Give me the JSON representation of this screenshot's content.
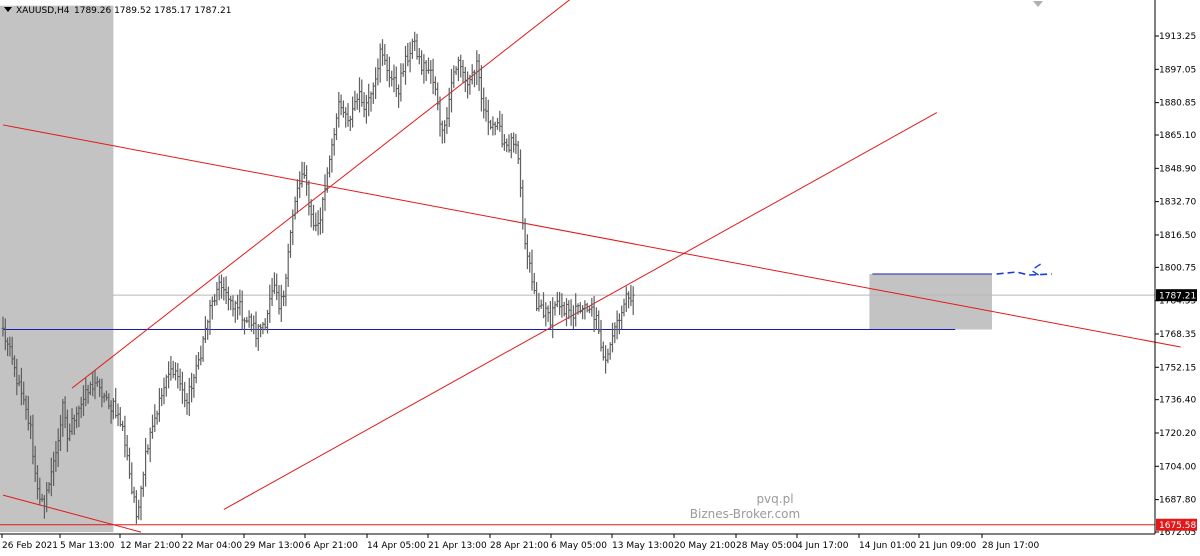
{
  "header": {
    "symbol": "XAUUSD,H4",
    "ohlc": "1789.26 1789.52 1785.17 1787.21"
  },
  "watermark": {
    "line1": "pvq.pl",
    "line2": "Biznes-Broker.com"
  },
  "price_badges": {
    "current": {
      "value": 1787.21,
      "label": "1787.21",
      "bg": "#000000",
      "fg": "#ffffff"
    },
    "low": {
      "value": 1675.58,
      "label": "1675.58",
      "bg": "#e31818",
      "fg": "#ffffff"
    }
  },
  "colors": {
    "candle": "#5f5f5f",
    "trendline": "#e31818",
    "level": "#1c1cb5",
    "forecast": "#1a3fd6",
    "shade": "#c3c3c3",
    "grid_current": "#b8b8b8"
  },
  "chart_data": {
    "type": "bar",
    "subtype": "ohlc",
    "symbol": "XAUUSD",
    "timeframe": "H4",
    "ylim": [
      1670.0,
      1930.0
    ],
    "y_ticks": [
      1913.25,
      1897.05,
      1880.85,
      1865.1,
      1848.9,
      1832.7,
      1816.5,
      1800.75,
      1784.55,
      1768.35,
      1752.15,
      1736.4,
      1720.2,
      1704.0,
      1687.8,
      1672.05
    ],
    "y_tick_labels": [
      "1913.25",
      "1897.05",
      "1880.85",
      "1865.10",
      "1848.90",
      "1832.70",
      "1816.50",
      "1800.75",
      "1784.55",
      "1768.35",
      "1752.15",
      "1736.40",
      "1720.20",
      "1704.00",
      "1687.80",
      "1672.05"
    ],
    "x_tick_labels": [
      "26 Feb 2021",
      "5 Mar 13:00",
      "12 Mar 21:00",
      "22 Mar 04:00",
      "29 Mar 13:00",
      "6 Apr 21:00",
      "14 Apr 05:00",
      "21 Apr 13:00",
      "28 Apr 21:00",
      "6 May 05:00",
      "13 May 13:00",
      "20 May 21:00",
      "28 May 05:00",
      "4 Jun 17:00",
      "14 Jun 01:00",
      "21 Jun 09:00",
      "28 Jun 17:00"
    ],
    "close_path": [
      [
        0,
        1770
      ],
      [
        2,
        1755
      ],
      [
        4,
        1738
      ],
      [
        6,
        1722
      ],
      [
        7,
        1700
      ],
      [
        8,
        1690
      ],
      [
        9,
        1682
      ],
      [
        10,
        1698
      ],
      [
        11,
        1705
      ],
      [
        12,
        1718
      ],
      [
        13,
        1732
      ],
      [
        14,
        1718
      ],
      [
        15,
        1725
      ],
      [
        16,
        1732
      ],
      [
        17,
        1735
      ],
      [
        18,
        1738
      ],
      [
        19,
        1742
      ],
      [
        20,
        1745
      ],
      [
        21,
        1740
      ],
      [
        22,
        1738
      ],
      [
        23,
        1732
      ],
      [
        24,
        1735
      ],
      [
        25,
        1728
      ],
      [
        26,
        1722
      ],
      [
        27,
        1710
      ],
      [
        28,
        1692
      ],
      [
        29,
        1680
      ],
      [
        30,
        1695
      ],
      [
        31,
        1710
      ],
      [
        32,
        1722
      ],
      [
        33,
        1728
      ],
      [
        34,
        1735
      ],
      [
        35,
        1742
      ],
      [
        36,
        1748
      ],
      [
        37,
        1752
      ],
      [
        38,
        1748
      ],
      [
        39,
        1740
      ],
      [
        40,
        1735
      ],
      [
        41,
        1744
      ],
      [
        42,
        1750
      ],
      [
        43,
        1760
      ],
      [
        44,
        1770
      ],
      [
        45,
        1780
      ],
      [
        46,
        1786
      ],
      [
        47,
        1790
      ],
      [
        48,
        1792
      ],
      [
        49,
        1784
      ],
      [
        50,
        1780
      ],
      [
        51,
        1784
      ],
      [
        52,
        1778
      ],
      [
        53,
        1775
      ],
      [
        54,
        1774
      ],
      [
        55,
        1768
      ],
      [
        56,
        1772
      ],
      [
        57,
        1775
      ],
      [
        58,
        1784
      ],
      [
        59,
        1790
      ],
      [
        60,
        1780
      ],
      [
        61,
        1788
      ],
      [
        62,
        1810
      ],
      [
        63,
        1825
      ],
      [
        64,
        1838
      ],
      [
        65,
        1845
      ],
      [
        66,
        1840
      ],
      [
        67,
        1826
      ],
      [
        68,
        1820
      ],
      [
        69,
        1825
      ],
      [
        70,
        1840
      ],
      [
        71,
        1855
      ],
      [
        72,
        1868
      ],
      [
        73,
        1878
      ],
      [
        74,
        1876
      ],
      [
        75,
        1870
      ],
      [
        76,
        1878
      ],
      [
        77,
        1885
      ],
      [
        78,
        1882
      ],
      [
        79,
        1880
      ],
      [
        80,
        1888
      ],
      [
        81,
        1895
      ],
      [
        82,
        1905
      ],
      [
        83,
        1900
      ],
      [
        84,
        1895
      ],
      [
        85,
        1890
      ],
      [
        86,
        1888
      ],
      [
        87,
        1897
      ],
      [
        88,
        1903
      ],
      [
        89,
        1910
      ],
      [
        90,
        1905
      ],
      [
        91,
        1898
      ],
      [
        92,
        1898
      ],
      [
        93,
        1895
      ],
      [
        94,
        1886
      ],
      [
        95,
        1872
      ],
      [
        96,
        1868
      ],
      [
        97,
        1885
      ],
      [
        98,
        1896
      ],
      [
        99,
        1900
      ],
      [
        100,
        1895
      ],
      [
        101,
        1890
      ],
      [
        102,
        1895
      ],
      [
        103,
        1898
      ],
      [
        104,
        1882
      ],
      [
        105,
        1874
      ],
      [
        106,
        1872
      ],
      [
        107,
        1870
      ],
      [
        108,
        1866
      ],
      [
        109,
        1862
      ],
      [
        110,
        1860
      ],
      [
        111,
        1862
      ],
      [
        112,
        1852
      ],
      [
        113,
        1820
      ],
      [
        114,
        1805
      ],
      [
        115,
        1795
      ],
      [
        116,
        1780
      ],
      [
        117,
        1782
      ],
      [
        118,
        1778
      ],
      [
        119,
        1776
      ],
      [
        120,
        1784
      ],
      [
        121,
        1780
      ],
      [
        122,
        1778
      ],
      [
        123,
        1782
      ],
      [
        124,
        1778
      ],
      [
        125,
        1780
      ],
      [
        126,
        1782
      ],
      [
        127,
        1778
      ],
      [
        128,
        1780
      ],
      [
        129,
        1775
      ],
      [
        130,
        1760
      ],
      [
        131,
        1758
      ],
      [
        132,
        1765
      ],
      [
        133,
        1772
      ],
      [
        134,
        1778
      ],
      [
        135,
        1782
      ],
      [
        136,
        1788
      ],
      [
        137,
        1787.21
      ]
    ],
    "trendlines": [
      {
        "name": "channel-upper",
        "p1": [
          15,
          1742
        ],
        "p2": [
          137,
          1955
        ]
      },
      {
        "name": "channel-lower",
        "p1": [
          48,
          1683
        ],
        "p2": [
          203,
          1876
        ]
      },
      {
        "name": "descending",
        "p1": [
          0,
          1870
        ],
        "p2": [
          256,
          1762
        ]
      },
      {
        "name": "lower-descending",
        "p1": [
          0,
          1690
        ],
        "p2": [
          30,
          1672
        ]
      }
    ],
    "horizontal_levels": [
      {
        "name": "support",
        "value": 1770.5,
        "x_range": [
          0,
          207
        ]
      },
      {
        "name": "range-top",
        "value": 1797.5,
        "x_range": [
          189,
          215
        ]
      },
      {
        "name": "low",
        "value": 1675.58
      },
      {
        "name": "current",
        "value": 1787.21
      }
    ],
    "shaded_regions": [
      {
        "name": "history",
        "x_range": [
          0,
          24
        ],
        "y_range": [
          1672,
          1928
        ]
      },
      {
        "name": "consolidation",
        "x_range": [
          189,
          215
        ],
        "y_range": [
          1770.5,
          1797.5
        ]
      }
    ],
    "forecast": {
      "type": "dashed",
      "value": 1797.5,
      "x_range": [
        216,
        228
      ]
    },
    "x_axis": {
      "bars": 250
    }
  }
}
